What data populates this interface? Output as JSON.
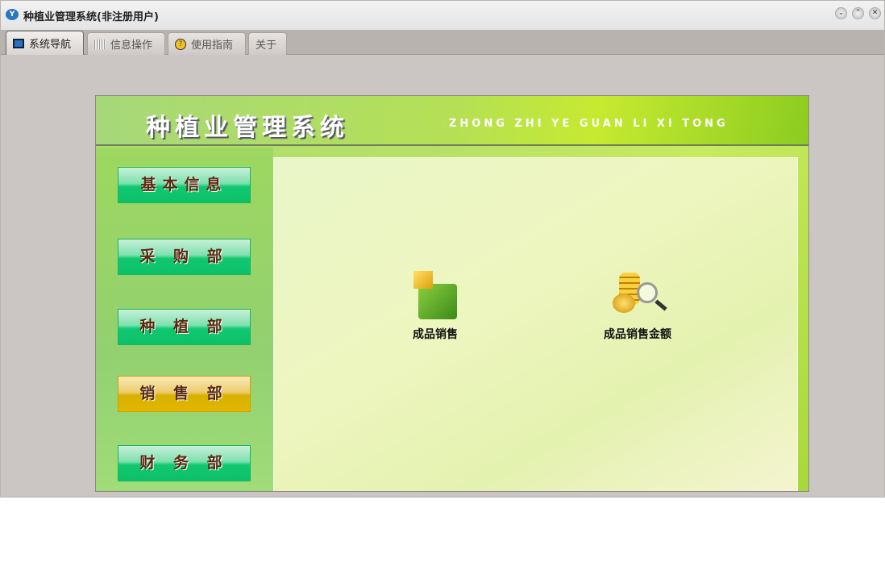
{
  "window": {
    "title": "种植业管理系统(非注册用户)"
  },
  "tabs": [
    {
      "label": "系统导航"
    },
    {
      "label": "信息操作"
    },
    {
      "label": "使用指南"
    },
    {
      "label": "关于"
    }
  ],
  "header": {
    "title": "种植业管理系统",
    "pinyin": "ZHONG ZHI YE GUAN LI XI TONG"
  },
  "sidebar": {
    "items": [
      {
        "label": "基本信息"
      },
      {
        "label": "采 购 部"
      },
      {
        "label": "种 植 部"
      },
      {
        "label": "销 售 部"
      },
      {
        "label": "财 务 部"
      }
    ]
  },
  "content": {
    "items": [
      {
        "label": "成品销售",
        "icon": "green-box-icon"
      },
      {
        "label": "成品销售金额",
        "icon": "coins-magnifier-icon"
      }
    ]
  }
}
